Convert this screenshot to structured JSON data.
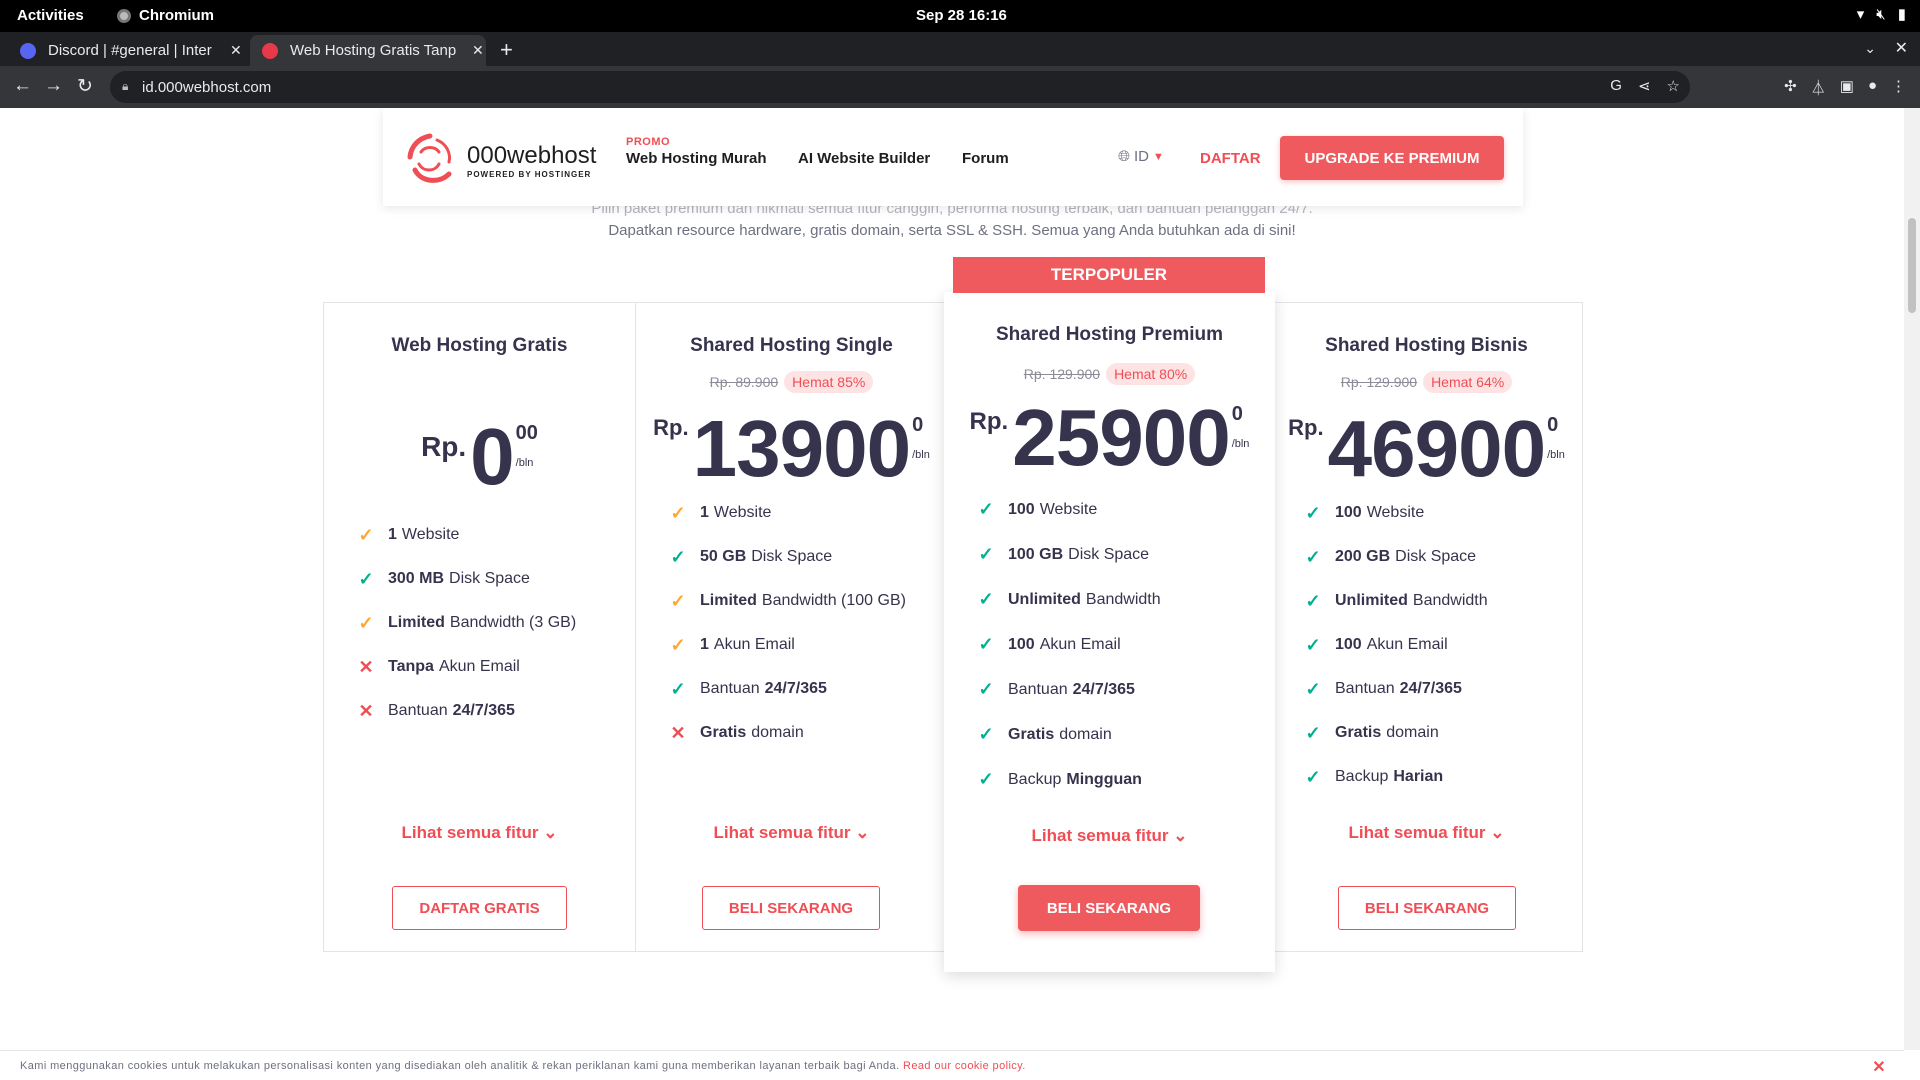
{
  "os": {
    "activities": "Activities",
    "app_name": "Chromium",
    "clock": "Sep 28  16:16"
  },
  "browser": {
    "tabs": [
      {
        "title": "Discord | #general | Inter"
      },
      {
        "title": "Web Hosting Gratis Tanp"
      }
    ],
    "url": "id.000webhost.com"
  },
  "header": {
    "logo_name": "000webhost",
    "logo_tagline": "POWERED BY HOSTINGER",
    "promo_label": "PROMO",
    "nav": [
      "Web Hosting Murah",
      "AI Website Builder",
      "Forum"
    ],
    "lang": "ID",
    "signup": "DAFTAR",
    "upgrade": "UPGRADE KE PREMIUM"
  },
  "intro": {
    "line1": "Pilih paket premium dan nikmati semua fitur canggih, performa hosting terbaik, dan bantuan pelanggan 24/7.",
    "line2": "Dapatkan resource hardware, gratis domain, serta SSL & SSH. Semua yang Anda butuhkan ada di sini!"
  },
  "plans": [
    {
      "title": "Web Hosting Gratis",
      "currency": "Rp.",
      "price": "0",
      "cents": "00",
      "period": "/bln",
      "features": [
        {
          "status": "warn",
          "bold": "1",
          "text": "Website"
        },
        {
          "status": "ok",
          "bold": "300 MB",
          "text": "Disk Space"
        },
        {
          "status": "warn",
          "bold": "Limited",
          "text": "Bandwidth (3 GB)"
        },
        {
          "status": "no",
          "bold": "Tanpa",
          "text": "Akun Email"
        },
        {
          "status": "no",
          "text": "Bantuan",
          "bold_after": "24/7/365"
        }
      ],
      "see_all": "Lihat semua fitur",
      "cta": "DAFTAR GRATIS"
    },
    {
      "title": "Shared Hosting Single",
      "old_price": "Rp. 89.900",
      "save": "Hemat 85%",
      "currency": "Rp.",
      "price": "13900",
      "cents": "0",
      "period": "/bln",
      "features": [
        {
          "status": "warn",
          "bold": "1",
          "text": "Website"
        },
        {
          "status": "ok",
          "bold": "50 GB",
          "text": "Disk Space"
        },
        {
          "status": "warn",
          "bold": "Limited",
          "text": "Bandwidth (100 GB)"
        },
        {
          "status": "warn",
          "bold": "1",
          "text": "Akun Email"
        },
        {
          "status": "ok",
          "text": "Bantuan",
          "bold_after": "24/7/365"
        },
        {
          "status": "no",
          "bold": "Gratis",
          "text": "domain"
        }
      ],
      "see_all": "Lihat semua fitur",
      "cta": "BELI SEKARANG"
    },
    {
      "badge": "TERPOPULER",
      "title": "Shared Hosting Premium",
      "old_price": "Rp. 129.900",
      "save": "Hemat 80%",
      "currency": "Rp.",
      "price": "25900",
      "cents": "0",
      "period": "/bln",
      "features": [
        {
          "status": "ok",
          "bold": "100",
          "text": "Website"
        },
        {
          "status": "ok",
          "bold": "100 GB",
          "text": "Disk Space"
        },
        {
          "status": "ok",
          "bold": "Unlimited",
          "text": "Bandwidth"
        },
        {
          "status": "ok",
          "bold": "100",
          "text": "Akun Email"
        },
        {
          "status": "ok",
          "text": "Bantuan",
          "bold_after": "24/7/365"
        },
        {
          "status": "ok",
          "bold": "Gratis",
          "text": "domain"
        },
        {
          "status": "ok",
          "text": "Backup",
          "bold_after": "Mingguan"
        }
      ],
      "see_all": "Lihat semua fitur",
      "cta": "BELI SEKARANG"
    },
    {
      "title": "Shared Hosting Bisnis",
      "old_price": "Rp. 129.900",
      "save": "Hemat 64%",
      "currency": "Rp.",
      "price": "46900",
      "cents": "0",
      "period": "/bln",
      "features": [
        {
          "status": "ok",
          "bold": "100",
          "text": "Website"
        },
        {
          "status": "ok",
          "bold": "200 GB",
          "text": "Disk Space"
        },
        {
          "status": "ok",
          "bold": "Unlimited",
          "text": "Bandwidth"
        },
        {
          "status": "ok",
          "bold": "100",
          "text": "Akun Email"
        },
        {
          "status": "ok",
          "text": "Bantuan",
          "bold_after": "24/7/365"
        },
        {
          "status": "ok",
          "bold": "Gratis",
          "text": "domain"
        },
        {
          "status": "ok",
          "text": "Backup",
          "bold_after": "Harian"
        }
      ],
      "see_all": "Lihat semua fitur",
      "cta": "BELI SEKARANG"
    }
  ],
  "cookie": {
    "text": "Kami menggunakan cookies untuk melakukan personalisasi konten yang disediakan oleh analitik & rekan periklanan kami guna memberikan layanan terbaik bagi Anda.",
    "link": "Read our cookie policy."
  },
  "colors": {
    "brand": "#ef4e55",
    "ok": "#00b090",
    "warn": "#ffa630",
    "text": "#36344d"
  }
}
